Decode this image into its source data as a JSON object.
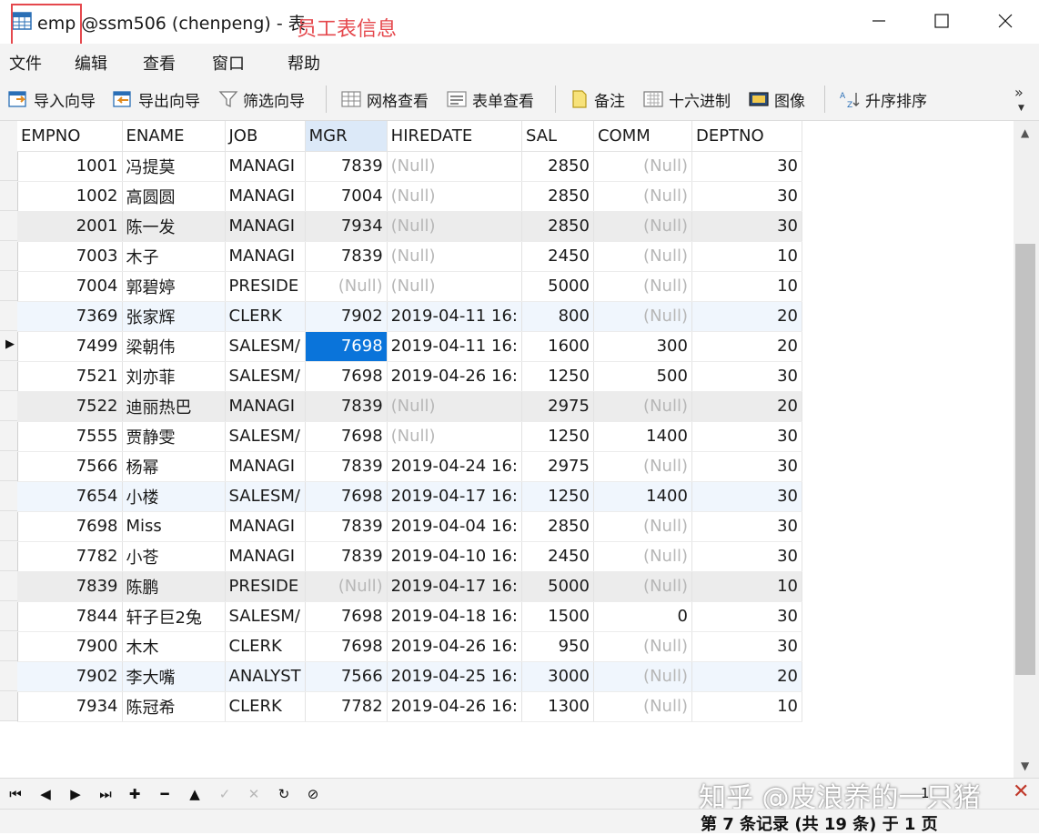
{
  "window": {
    "title": "emp @ssm506 (chenpeng) - 表",
    "annotation": "员工表信息"
  },
  "menu": [
    "文件",
    "编辑",
    "查看",
    "窗口",
    "帮助"
  ],
  "toolbar": {
    "import_wizard": "导入向导",
    "export_wizard": "导出向导",
    "filter_wizard": "筛选向导",
    "grid_view": "网格查看",
    "form_view": "表单查看",
    "memo": "备注",
    "hex": "十六进制",
    "image": "图像",
    "sort_asc": "升序排序",
    "more": "»"
  },
  "grid": {
    "columns": [
      "EMPNO",
      "ENAME",
      "JOB",
      "MGR",
      "HIREDATE",
      "SAL",
      "COMM",
      "DEPTNO"
    ],
    "sorted_column": "MGR",
    "current_row_index": 6,
    "selected_cell": "MGR",
    "rows": [
      {
        "empno": "1001",
        "ename": "冯提莫",
        "job": "MANAGI",
        "mgr": "7839",
        "hiredate": "(Null)",
        "sal": "2850",
        "comm": "(Null)",
        "deptno": "30"
      },
      {
        "empno": "1002",
        "ename": "高圆圆",
        "job": "MANAGI",
        "mgr": "7004",
        "hiredate": "(Null)",
        "sal": "2850",
        "comm": "(Null)",
        "deptno": "30"
      },
      {
        "empno": "2001",
        "ename": "陈一发",
        "job": "MANAGI",
        "mgr": "7934",
        "hiredate": "(Null)",
        "sal": "2850",
        "comm": "(Null)",
        "deptno": "30"
      },
      {
        "empno": "7003",
        "ename": "木子",
        "job": "MANAGI",
        "mgr": "7839",
        "hiredate": "(Null)",
        "sal": "2450",
        "comm": "(Null)",
        "deptno": "10"
      },
      {
        "empno": "7004",
        "ename": "郭碧婷",
        "job": "PRESIDE",
        "mgr": "(Null)",
        "hiredate": "(Null)",
        "sal": "5000",
        "comm": "(Null)",
        "deptno": "10"
      },
      {
        "empno": "7369",
        "ename": "张家辉",
        "job": "CLERK",
        "mgr": "7902",
        "hiredate": "2019-04-11 16:",
        "sal": "800",
        "comm": "(Null)",
        "deptno": "20"
      },
      {
        "empno": "7499",
        "ename": "梁朝伟",
        "job": "SALESM/",
        "mgr": "7698",
        "hiredate": "2019-04-11 16:",
        "sal": "1600",
        "comm": "300",
        "deptno": "20"
      },
      {
        "empno": "7521",
        "ename": "刘亦菲",
        "job": "SALESM/",
        "mgr": "7698",
        "hiredate": "2019-04-26 16:",
        "sal": "1250",
        "comm": "500",
        "deptno": "30"
      },
      {
        "empno": "7522",
        "ename": "迪丽热巴",
        "job": "MANAGI",
        "mgr": "7839",
        "hiredate": "(Null)",
        "sal": "2975",
        "comm": "(Null)",
        "deptno": "20"
      },
      {
        "empno": "7555",
        "ename": "贾静雯",
        "job": "SALESM/",
        "mgr": "7698",
        "hiredate": "(Null)",
        "sal": "1250",
        "comm": "1400",
        "deptno": "30"
      },
      {
        "empno": "7566",
        "ename": "杨幂",
        "job": "MANAGI",
        "mgr": "7839",
        "hiredate": "2019-04-24 16:",
        "sal": "2975",
        "comm": "(Null)",
        "deptno": "30"
      },
      {
        "empno": "7654",
        "ename": "小楼",
        "job": "SALESM/",
        "mgr": "7698",
        "hiredate": "2019-04-17 16:",
        "sal": "1250",
        "comm": "1400",
        "deptno": "30"
      },
      {
        "empno": "7698",
        "ename": "Miss",
        "job": "MANAGI",
        "mgr": "7839",
        "hiredate": "2019-04-04 16:",
        "sal": "2850",
        "comm": "(Null)",
        "deptno": "30"
      },
      {
        "empno": "7782",
        "ename": "小苍",
        "job": "MANAGI",
        "mgr": "7839",
        "hiredate": "2019-04-10 16:",
        "sal": "2450",
        "comm": "(Null)",
        "deptno": "30"
      },
      {
        "empno": "7839",
        "ename": "陈鹏",
        "job": "PRESIDE",
        "mgr": "(Null)",
        "hiredate": "2019-04-17 16:",
        "sal": "5000",
        "comm": "(Null)",
        "deptno": "10"
      },
      {
        "empno": "7844",
        "ename": "轩子巨2兔",
        "job": "SALESM/",
        "mgr": "7698",
        "hiredate": "2019-04-18 16:",
        "sal": "1500",
        "comm": "0",
        "deptno": "30"
      },
      {
        "empno": "7900",
        "ename": "木木",
        "job": "CLERK",
        "mgr": "7698",
        "hiredate": "2019-04-26 16:",
        "sal": "950",
        "comm": "(Null)",
        "deptno": "30"
      },
      {
        "empno": "7902",
        "ename": "李大嘴",
        "job": "ANALYST",
        "mgr": "7566",
        "hiredate": "2019-04-25 16:",
        "sal": "3000",
        "comm": "(Null)",
        "deptno": "20"
      },
      {
        "empno": "7934",
        "ename": "陈冠希",
        "job": "CLERK",
        "mgr": "7782",
        "hiredate": "2019-04-26 16:",
        "sal": "1300",
        "comm": "(Null)",
        "deptno": "10"
      }
    ]
  },
  "navigation": {
    "page_input": "1",
    "status": "第 7 条记录 (共 19 条) 于 1 页",
    "watermark": "知乎 @皮浪养的一只猪"
  }
}
